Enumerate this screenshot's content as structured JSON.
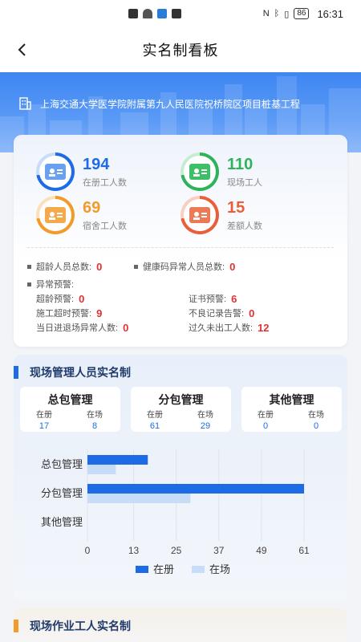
{
  "status_bar": {
    "battery": "86",
    "time": "16:31"
  },
  "nav": {
    "title": "实名制看板"
  },
  "banner": {
    "project_name": "上海交通大学医学院附属第九人民医院祝桥院区项目桩基工程"
  },
  "stats": {
    "items": [
      {
        "value": "194",
        "label": "在册工人数",
        "color": "#1e6be6"
      },
      {
        "value": "110",
        "label": "现场工人",
        "color": "#2fb35a"
      },
      {
        "value": "69",
        "label": "宿舍工人数",
        "color": "#f39b2a"
      },
      {
        "value": "15",
        "label": "差额人数",
        "color": "#e8603a"
      }
    ],
    "over_age_total_label": "超龄人员总数:",
    "over_age_total_value": "0",
    "health_code_abnormal_label": "健康码异常人员总数:",
    "health_code_abnormal_value": "0",
    "abnormal_warning_label": "异常预警:",
    "warnings": [
      {
        "label": "超龄预警:",
        "value": "0"
      },
      {
        "label": "证书预警:",
        "value": "6"
      },
      {
        "label": "施工超时预警:",
        "value": "9"
      },
      {
        "label": "不良记录告警:",
        "value": "0"
      },
      {
        "label": "当日进退场异常人数:",
        "value": "0"
      },
      {
        "label": "过久未出工人数:",
        "value": "12"
      }
    ]
  },
  "management": {
    "section_title": "现场管理人员实名制",
    "groups": [
      {
        "title": "总包管理",
        "registered_label": "在册",
        "registered": "17",
        "onsite_label": "在场",
        "onsite": "8"
      },
      {
        "title": "分包管理",
        "registered_label": "在册",
        "registered": "61",
        "onsite_label": "在场",
        "onsite": "29"
      },
      {
        "title": "其他管理",
        "registered_label": "在册",
        "registered": "0",
        "onsite_label": "在场",
        "onsite": "0"
      }
    ]
  },
  "chart_data": {
    "type": "bar",
    "orientation": "horizontal",
    "categories": [
      "总包管理",
      "分包管理",
      "其他管理"
    ],
    "series": [
      {
        "name": "在册",
        "values": [
          17,
          61,
          0
        ],
        "color": "#1e6be6"
      },
      {
        "name": "在场",
        "values": [
          8,
          29,
          0
        ],
        "color": "#c7dcf7"
      }
    ],
    "xticks": [
      "0",
      "13",
      "25",
      "37",
      "49",
      "61"
    ],
    "xlim": [
      0,
      61
    ],
    "grid": true,
    "legend_position": "bottom-center"
  },
  "workers": {
    "section_title": "现场作业工人实名制"
  }
}
